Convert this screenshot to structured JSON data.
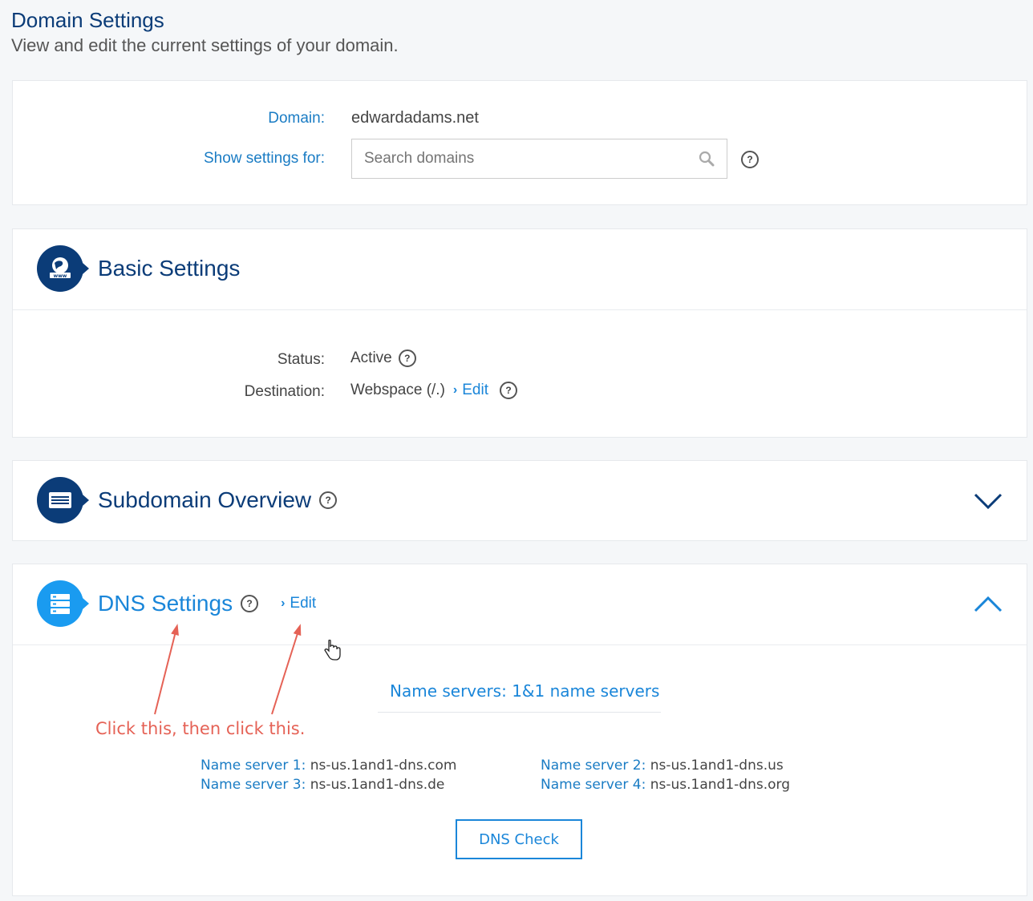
{
  "page": {
    "title": "Domain Settings",
    "subtitle": "View and edit the current settings of your domain."
  },
  "domain_card": {
    "domain_label": "Domain:",
    "domain_value": "edwardadams.net",
    "show_label": "Show settings for:",
    "search_placeholder": "Search domains",
    "search_icon": "search-icon",
    "help_icon": "help-icon"
  },
  "basic": {
    "title": "Basic Settings",
    "icon": "www-globe-icon",
    "status_label": "Status:",
    "status_value": "Active",
    "destination_label": "Destination:",
    "destination_value": "Webspace (/.)",
    "edit_link": "Edit"
  },
  "subdomain": {
    "title": "Subdomain Overview",
    "icon": "list-icon",
    "chevron": "chevron-down-icon"
  },
  "dns": {
    "title": "DNS Settings",
    "icon": "server-icon",
    "edit_link": "Edit",
    "chevron": "chevron-up-icon",
    "name_servers_heading": "Name servers: 1&1 name servers",
    "servers": [
      {
        "label": "Name server 1:",
        "value": "ns-us.1and1-dns.com"
      },
      {
        "label": "Name server 2:",
        "value": "ns-us.1and1-dns.us"
      },
      {
        "label": "Name server 3:",
        "value": "ns-us.1and1-dns.de"
      },
      {
        "label": "Name server 4:",
        "value": "ns-us.1and1-dns.org"
      }
    ],
    "check_button": "DNS Check"
  },
  "annotation": {
    "text": "Click this, then click this."
  },
  "colors": {
    "brand_dark": "#0b3c78",
    "brand_light": "#1a9bf0",
    "link": "#1a86d9",
    "annotation": "#e56256"
  }
}
